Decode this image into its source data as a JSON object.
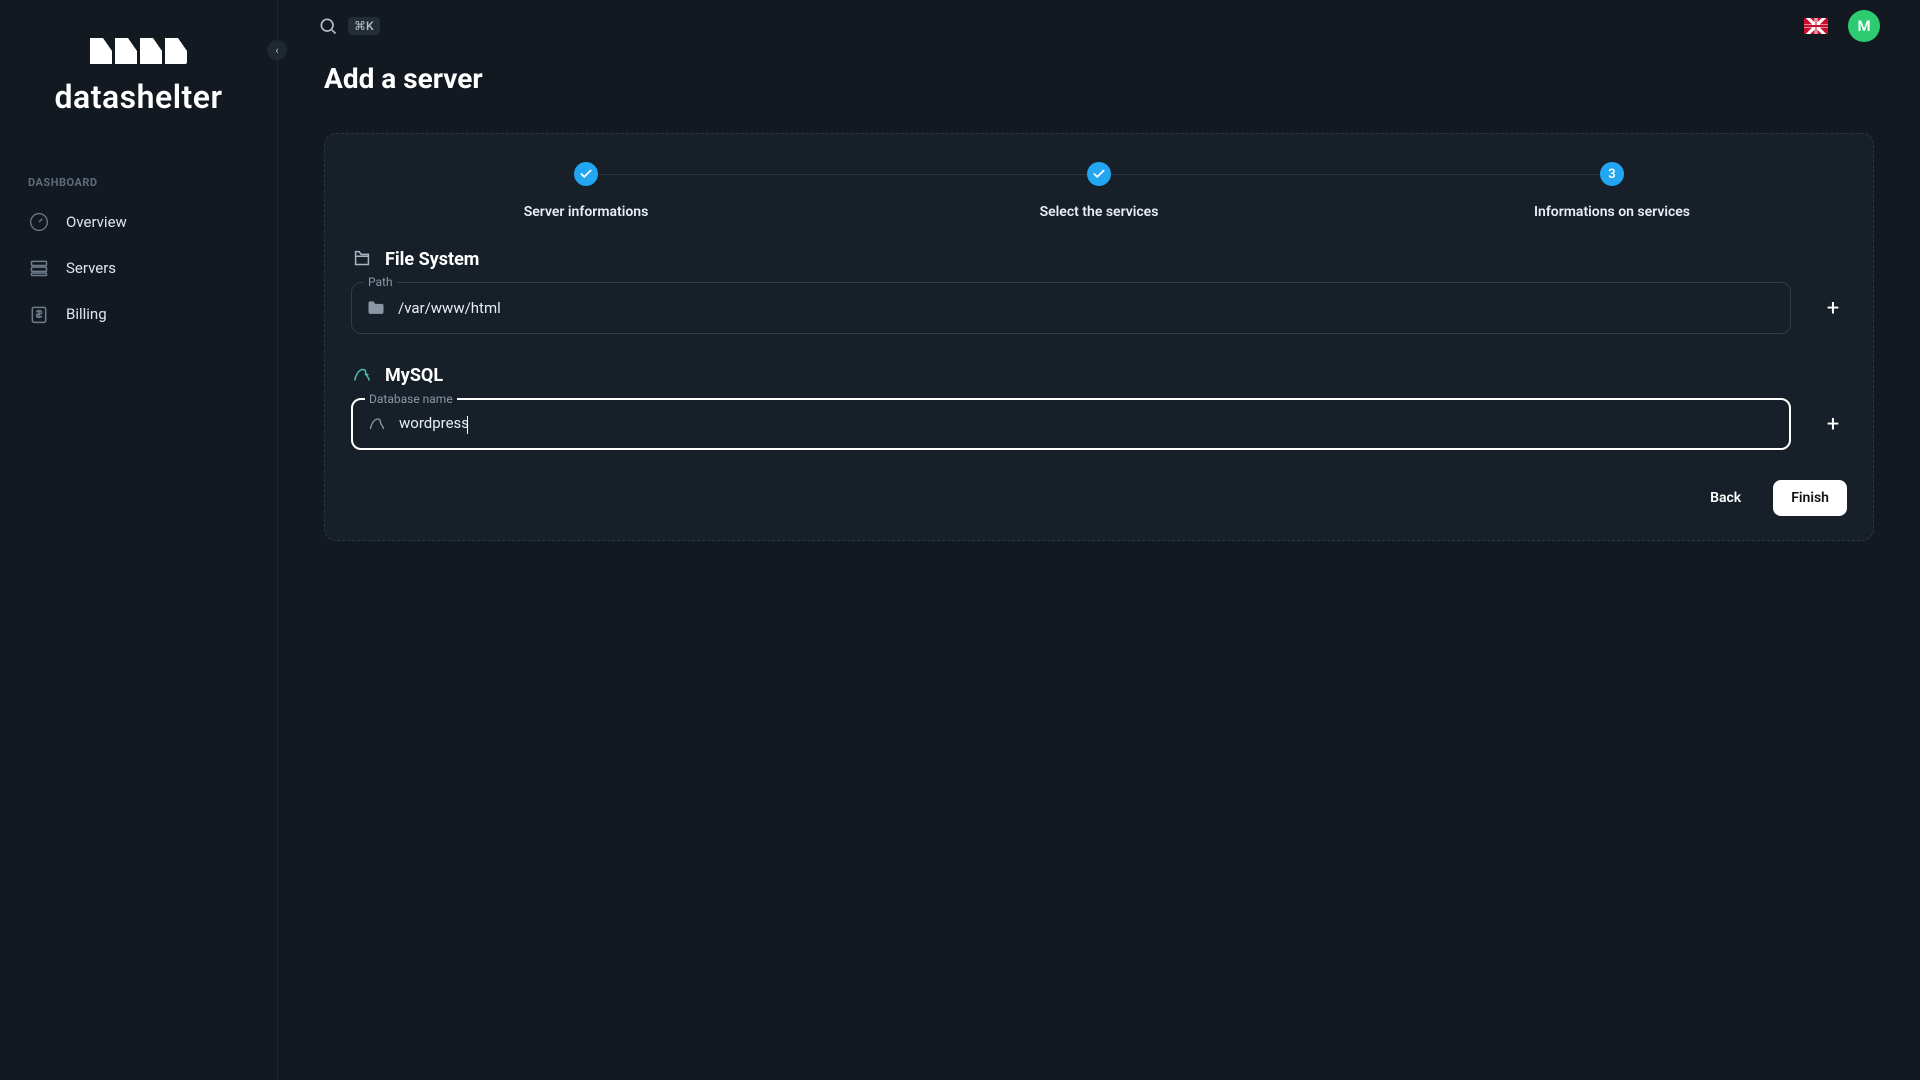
{
  "brand": {
    "name": "datashelter"
  },
  "sidebar": {
    "section_label": "DASHBOARD",
    "items": [
      {
        "label": "Overview"
      },
      {
        "label": "Servers"
      },
      {
        "label": "Billing"
      }
    ]
  },
  "topbar": {
    "shortcut": "⌘K",
    "avatar_initial": "M"
  },
  "page": {
    "title": "Add a server",
    "steps": [
      {
        "label": "Server informations",
        "state": "done"
      },
      {
        "label": "Select the services",
        "state": "done"
      },
      {
        "label": "Informations on services",
        "state": "current",
        "number": "3"
      }
    ],
    "sections": [
      {
        "title": "File System",
        "input_label": "Path",
        "value": "/var/www/html"
      },
      {
        "title": "MySQL",
        "input_label": "Database name",
        "value": "wordpress"
      }
    ],
    "buttons": {
      "back": "Back",
      "finish": "Finish"
    }
  }
}
